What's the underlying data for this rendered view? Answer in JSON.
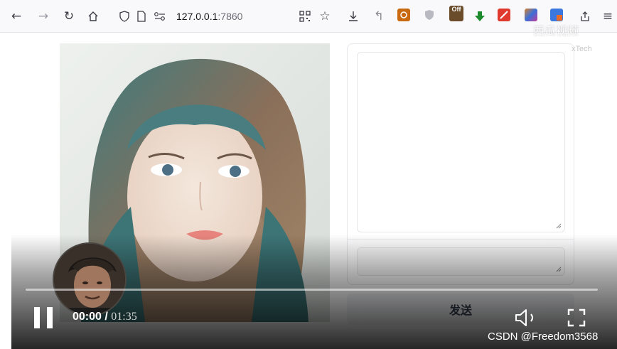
{
  "browser": {
    "url_host": "127.0.0.1",
    "url_port": ":7860",
    "extension_badge": "Off"
  },
  "chat": {
    "send_label": "发送"
  },
  "player": {
    "current_time": "00:00",
    "separator": " / ",
    "duration": "01:35",
    "watermark": "CSDN @Freedom3568",
    "logo_text": "西瓜视频",
    "logo_subtext": "xTech"
  },
  "colors": {
    "accent_red": "#e03a2f",
    "accent_green": "#1e8a2e",
    "accent_orange": "#d9822b"
  }
}
